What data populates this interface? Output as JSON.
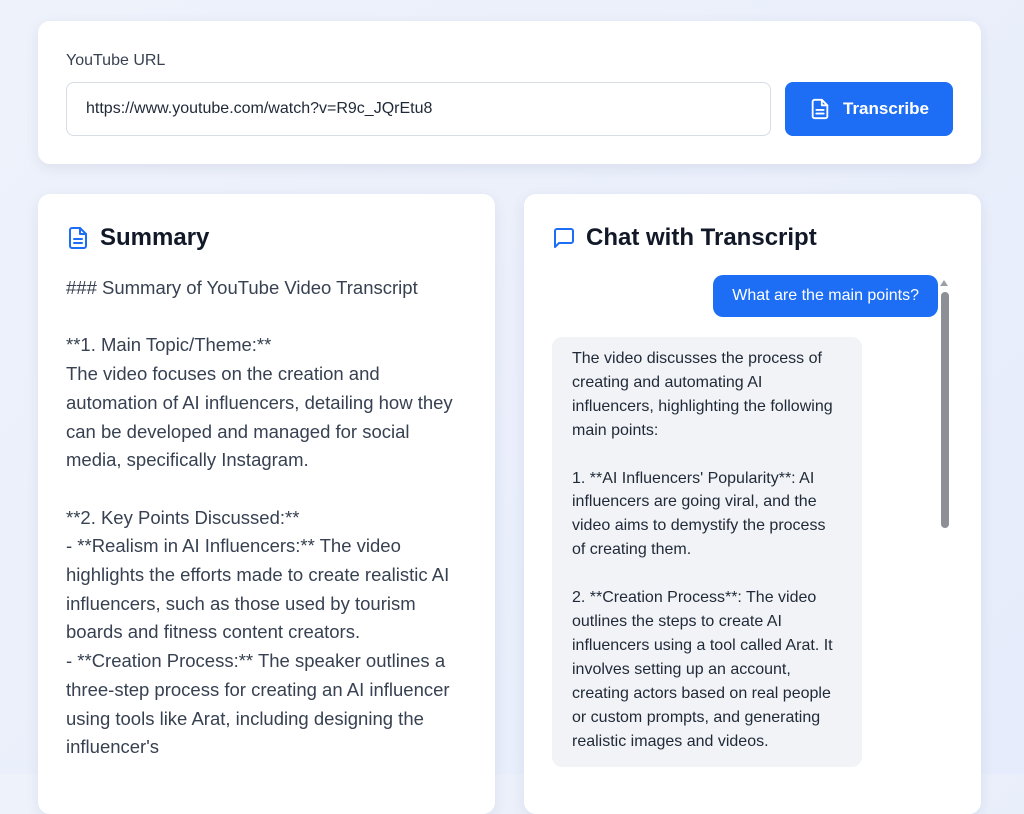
{
  "url_form": {
    "label": "YouTube URL",
    "value": "https://www.youtube.com/watch?v=R9c_JQrEtu8",
    "button_label": "Transcribe",
    "button_icon": "document-icon"
  },
  "summary": {
    "title": "Summary",
    "icon": "document-icon",
    "text": "### Summary of YouTube Video Transcript\n\n**1. Main Topic/Theme:**\nThe video focuses on the creation and automation of AI influencers, detailing how they can be developed and managed for social media, specifically Instagram.\n\n**2. Key Points Discussed:**\n- **Realism in AI Influencers:** The video highlights the efforts made to create realistic AI influencers, such as those used by tourism boards and fitness content creators.\n- **Creation Process:** The speaker outlines a three-step process for creating an AI influencer using tools like Arat, including designing the influencer's"
  },
  "chat": {
    "title": "Chat with Transcript",
    "icon": "chat-bubble-icon",
    "user_message": "What are the main points?",
    "assistant_message": "The video discusses the process of creating and automating AI influencers, highlighting the following main points:\n\n1. **AI Influencers' Popularity**: AI influencers are going viral, and the video aims to demystify the process of creating them.\n\n2. **Creation Process**: The video outlines the steps to create AI influencers using a tool called Arat. It involves setting up an account, creating actors based on real people or custom prompts, and generating realistic images and videos."
  },
  "colors": {
    "accent": "#1d6ef5",
    "background": "#e9eefb",
    "assistant_bubble": "#f1f3f6"
  }
}
